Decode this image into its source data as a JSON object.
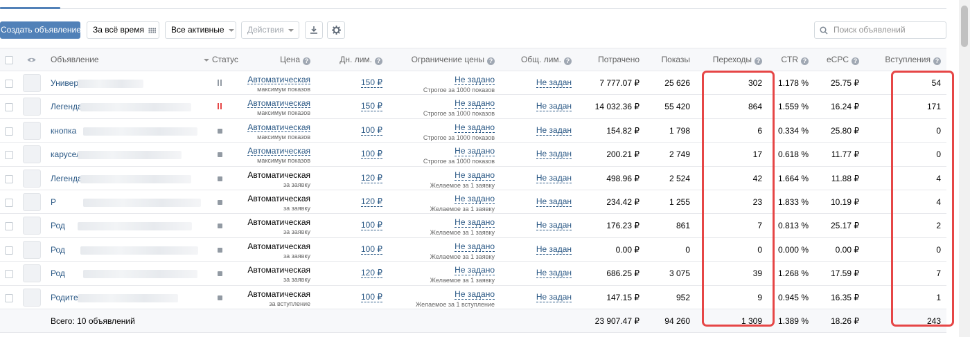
{
  "toolbar": {
    "create_label": "Создать объявление",
    "period_label": "За всё время",
    "filter_label": "Все активные",
    "actions_label": "Действия",
    "search_placeholder": "Поиск объявлений"
  },
  "columns": {
    "ad": "Объявление",
    "status": "Статус",
    "price": "Цена",
    "daily_limit": "Дн. лим.",
    "price_cap": "Ограничение цены",
    "total_limit": "Общ. лим.",
    "spent": "Потрачено",
    "impressions": "Показы",
    "clicks": "Переходы",
    "ctr": "CTR",
    "ecpc": "eCPC",
    "joins": "Вступления"
  },
  "rows": [
    {
      "name": "Универс",
      "status": "paused",
      "price": "Автоматическая",
      "price_sub": "максимум показов",
      "price_link": true,
      "daily": "150 ₽",
      "cap": "Не задано",
      "cap_sub": "Строгое за 1000 показов",
      "total": "Не задан",
      "spent": "7 777.07 ₽",
      "impressions": "25 626",
      "clicks": "302",
      "ctr": "1.178 %",
      "ecpc": "25.75 ₽",
      "joins": "54"
    },
    {
      "name": "Легенда",
      "status": "paused-red",
      "price": "Автоматическая",
      "price_sub": "максимум показов",
      "price_link": true,
      "daily": "150 ₽",
      "cap": "Не задано",
      "cap_sub": "Строгое за 1000 показов",
      "total": "Не задан",
      "spent": "14 032.36 ₽",
      "impressions": "55 420",
      "clicks": "864",
      "ctr": "1.559 %",
      "ecpc": "16.24 ₽",
      "joins": "171"
    },
    {
      "name": "кнопка",
      "status": "stopped",
      "price": "Автоматическая",
      "price_sub": "максимум показов",
      "price_link": true,
      "daily": "100 ₽",
      "cap": "Не задано",
      "cap_sub": "Строгое за 1000 показов",
      "total": "Не задан",
      "spent": "154.82 ₽",
      "impressions": "1 798",
      "clicks": "6",
      "ctr": "0.334 %",
      "ecpc": "25.80 ₽",
      "joins": "0"
    },
    {
      "name": "карусель",
      "status": "stopped",
      "price": "Автоматическая",
      "price_sub": "максимум показов",
      "price_link": true,
      "daily": "100 ₽",
      "cap": "Не задано",
      "cap_sub": "Строгое за 1000 показов",
      "total": "Не задан",
      "spent": "200.21 ₽",
      "impressions": "2 749",
      "clicks": "17",
      "ctr": "0.618 %",
      "ecpc": "11.77 ₽",
      "joins": "0"
    },
    {
      "name": "Легенда",
      "status": "stopped",
      "price": "Автоматическая",
      "price_sub": "за заявку",
      "price_link": false,
      "daily": "120 ₽",
      "cap": "Не задано",
      "cap_sub": "Желаемое за 1 заявку",
      "total": "Не задан",
      "spent": "498.96 ₽",
      "impressions": "2 524",
      "clicks": "42",
      "ctr": "1.664 %",
      "ecpc": "11.88 ₽",
      "joins": "4"
    },
    {
      "name": "Р",
      "status": "stopped",
      "price": "Автоматическая",
      "price_sub": "за заявку",
      "price_link": false,
      "daily": "120 ₽",
      "cap": "Не задано",
      "cap_sub": "Желаемое за 1 заявку",
      "total": "Не задан",
      "spent": "234.42 ₽",
      "impressions": "1 255",
      "clicks": "23",
      "ctr": "1.833 %",
      "ecpc": "10.19 ₽",
      "joins": "4"
    },
    {
      "name": "Род",
      "status": "stopped",
      "price": "Автоматическая",
      "price_sub": "за заявку",
      "price_link": false,
      "daily": "100 ₽",
      "cap": "Не задано",
      "cap_sub": "Желаемое за 1 заявку",
      "total": "Не задан",
      "spent": "176.23 ₽",
      "impressions": "861",
      "clicks": "7",
      "ctr": "0.813 %",
      "ecpc": "25.17 ₽",
      "joins": "2"
    },
    {
      "name": "Род",
      "status": "stopped",
      "price": "Автоматическая",
      "price_sub": "за заявку",
      "price_link": false,
      "daily": "100 ₽",
      "cap": "Не задано",
      "cap_sub": "Желаемое за 1 заявку",
      "total": "Не задан",
      "spent": "0.00 ₽",
      "impressions": "0",
      "clicks": "0",
      "ctr": "0.000 %",
      "ecpc": "0.00 ₽",
      "joins": "0"
    },
    {
      "name": "Род",
      "status": "stopped",
      "price": "Автоматическая",
      "price_sub": "за заявку",
      "price_link": false,
      "daily": "120 ₽",
      "cap": "Не задано",
      "cap_sub": "Желаемое за 1 заявку",
      "total": "Не задан",
      "spent": "686.25 ₽",
      "impressions": "3 075",
      "clicks": "39",
      "ctr": "1.268 %",
      "ecpc": "17.59 ₽",
      "joins": "7"
    },
    {
      "name": "Родители",
      "status": "stopped",
      "price": "Автоматическая",
      "price_sub": "за вступление",
      "price_link": false,
      "daily": "100 ₽",
      "cap": "Не задано",
      "cap_sub": "Желаемое за 1 вступление",
      "total": "Не задан",
      "spent": "147.15 ₽",
      "impressions": "952",
      "clicks": "9",
      "ctr": "0.945 %",
      "ecpc": "16.35 ₽",
      "joins": "1"
    }
  ],
  "footer": {
    "summary": "Всего: 10 объявлений",
    "spent": "23 907.47 ₽",
    "impressions": "94 260",
    "clicks": "1 309",
    "ctr": "1.389 %",
    "ecpc": "18.26 ₽",
    "joins": "243"
  },
  "colors": {
    "accent": "#5181b8",
    "link": "#2a5885",
    "highlight": "#e64646"
  }
}
